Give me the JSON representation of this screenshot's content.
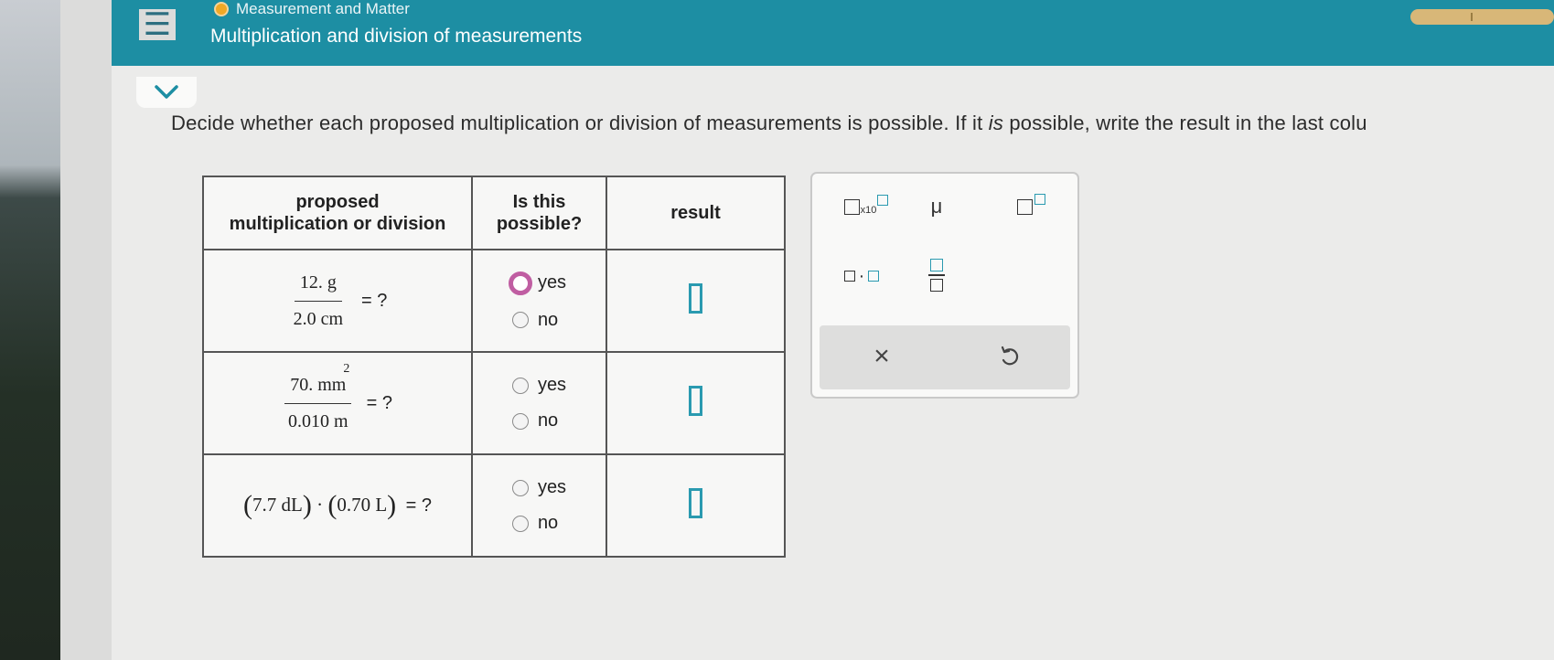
{
  "topbar": {
    "menu_icon": "hamburger-icon",
    "breadcrumb": "Measurement and Matter",
    "title": "Multiplication and division of measurements",
    "colors": {
      "bar": "#1d8ea3",
      "topic_dot": "#f0a825",
      "progress": "#d8b778"
    }
  },
  "instruction": {
    "part1": "Decide whether each proposed multiplication or division of measurements is possible. If it ",
    "emphasis": "is",
    "part2": " possible, write the result in the last colu"
  },
  "table": {
    "headers": {
      "col1_line1": "proposed",
      "col1_line2": "multiplication or division",
      "col2_line1": "Is this",
      "col2_line2": "possible?",
      "col3": "result"
    },
    "rows": [
      {
        "numerator": "12. g",
        "numerator_exp": "",
        "denominator": "2.0 cm",
        "equals": "= ?",
        "yes": "yes",
        "no": "no",
        "selected": "yes"
      },
      {
        "numerator": "70. mm",
        "numerator_exp": "2",
        "denominator": "0.010 m",
        "equals": "= ?",
        "yes": "yes",
        "no": "no",
        "selected": ""
      },
      {
        "product_a": "7.7 dL",
        "product_b": "0.70 L",
        "dot": "·",
        "equals": "= ?",
        "yes": "yes",
        "no": "no",
        "selected": ""
      }
    ]
  },
  "palette": {
    "sci_label": "x10",
    "mu": "μ",
    "dot": "·",
    "clear_icon": "×",
    "undo_icon": "↺"
  }
}
